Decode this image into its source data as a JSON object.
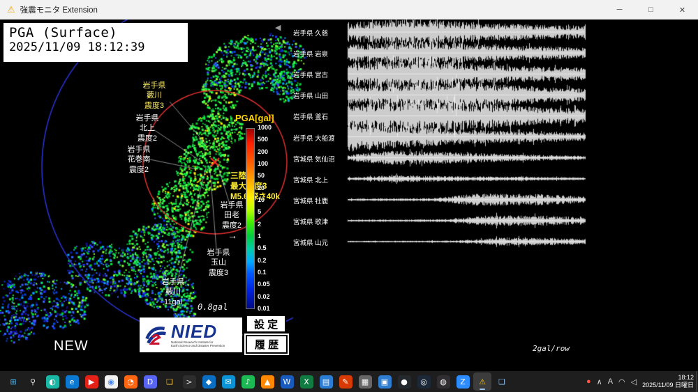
{
  "window": {
    "title": "強震モニタ Extension",
    "app_icon": "⚠",
    "controls": {
      "minimize": "─",
      "maximize": "□",
      "close": "✕"
    }
  },
  "monitor": {
    "mode": "PGA (Surface)",
    "datetime": "2025/11/09 18:12:39"
  },
  "legend": {
    "title": "PGA[gal]",
    "ticks": [
      "1000",
      "500",
      "200",
      "100",
      "50",
      "20",
      "10",
      "5",
      "2",
      "1",
      "0.5",
      "0.2",
      "0.1",
      "0.05",
      "0.02",
      "0.01"
    ],
    "current_arrow": "→"
  },
  "map_labels": {
    "yabukawa_intensity": "岩手県\n藪川\n震度3",
    "kitakami": "岩手県\n北上\n震度2",
    "hanamaki_minami": "岩手県\n花巻南\n震度2",
    "taro": "岩手県\n田老\n震度2",
    "tamayama": "岩手県\n玉山\n震度3",
    "yabukawa_gal": "岩手県\n藪川\n11gal",
    "gal_note": "0.8gal"
  },
  "epicenter": {
    "info": "三陸沖\n最大震度3\nM5.6 深さ40k"
  },
  "waveforms": {
    "marker": "◀",
    "row_scale": "2gal/row",
    "stations": [
      "岩手県 久慈",
      "岩手県 岩泉",
      "岩手県 宮古",
      "岩手県 山田",
      "岩手県 釜石",
      "岩手県 大船渡",
      "宮城県 気仙沼",
      "宮城県 北上",
      "宮城県 牡鹿",
      "宮城県 歌津",
      "宮城県 山元"
    ]
  },
  "nied": {
    "name": "NIED",
    "subtitle": "National Research Institute for\nEarth Science and Disaster Prevention"
  },
  "buttons": {
    "settings": "設 定",
    "history": "履 歴"
  },
  "new_badge": "NEW",
  "taskbar": {
    "icons": [
      {
        "name": "start-button",
        "glyph": "⊞",
        "color": "#4cc2ff",
        "bg": "none"
      },
      {
        "name": "search-button",
        "glyph": "⚲",
        "color": "#e8e8e8",
        "bg": "none"
      },
      {
        "name": "copilot-app",
        "glyph": "◐",
        "color": "#fff",
        "bg": "#19b8a6"
      },
      {
        "name": "edge-browser",
        "glyph": "e",
        "color": "#fff",
        "bg": "#0b78d1"
      },
      {
        "name": "youtube-app",
        "glyph": "▶",
        "color": "#fff",
        "bg": "#e62117"
      },
      {
        "name": "chrome-browser",
        "glyph": "◉",
        "color": "#4285f4",
        "bg": "#f1f1f1"
      },
      {
        "name": "firefox-browser",
        "glyph": "◔",
        "color": "#fff",
        "bg": "#ff6611"
      },
      {
        "name": "discord-app",
        "glyph": "D",
        "color": "#fff",
        "bg": "#5865f2"
      },
      {
        "name": "file-explorer",
        "glyph": "❏",
        "color": "#ffd04c",
        "bg": "none"
      },
      {
        "name": "terminal-app",
        "glyph": ">",
        "color": "#ddd",
        "bg": "#2d2d2d"
      },
      {
        "name": "vscode-app",
        "glyph": "◆",
        "color": "#fff",
        "bg": "#0a6fc2"
      },
      {
        "name": "mail-app",
        "glyph": "✉",
        "color": "#fff",
        "bg": "#0a93d6"
      },
      {
        "name": "spotify-app",
        "glyph": "♪",
        "color": "#fff",
        "bg": "#1db954"
      },
      {
        "name": "vlc-app",
        "glyph": "▲",
        "color": "#fff",
        "bg": "#ff8800"
      },
      {
        "name": "word-app",
        "glyph": "W",
        "color": "#fff",
        "bg": "#185abd"
      },
      {
        "name": "excel-app",
        "glyph": "X",
        "color": "#fff",
        "bg": "#107c41"
      },
      {
        "name": "notepad-app",
        "glyph": "▤",
        "color": "#fff",
        "bg": "#2b7cd3"
      },
      {
        "name": "paint-app",
        "glyph": "✎",
        "color": "#fff",
        "bg": "#d83b01"
      },
      {
        "name": "calculator-app",
        "glyph": "▦",
        "color": "#fff",
        "bg": "#666666"
      },
      {
        "name": "photos-app",
        "glyph": "▣",
        "color": "#fff",
        "bg": "#2e7dd1"
      },
      {
        "name": "github-app",
        "glyph": "●",
        "color": "#fff",
        "bg": "#24292e"
      },
      {
        "name": "steam-app",
        "glyph": "◎",
        "color": "#fff",
        "bg": "#1b2838"
      },
      {
        "name": "obs-app",
        "glyph": "◍",
        "color": "#fff",
        "bg": "#302e31"
      },
      {
        "name": "zoom-app",
        "glyph": "Z",
        "color": "#fff",
        "bg": "#2d8cff"
      },
      {
        "name": "kyoshin-monitor-app",
        "glyph": "⚠",
        "color": "#ffcc00",
        "bg": "#3c3c3c",
        "active": true
      },
      {
        "name": "folder-window",
        "glyph": "❏",
        "color": "#8ec6ff",
        "bg": "none"
      }
    ],
    "tray": {
      "icons": [
        {
          "name": "tray-app-icon",
          "glyph": "●",
          "color": "#ff5544"
        },
        {
          "name": "hidden-icons-chevron",
          "glyph": "∧",
          "color": "#ddd"
        },
        {
          "name": "ime-indicator",
          "glyph": "A",
          "color": "#ddd"
        },
        {
          "name": "network-icon",
          "glyph": "◠",
          "color": "#ddd"
        },
        {
          "name": "volume-icon",
          "glyph": "◁",
          "color": "#ddd"
        }
      ],
      "clock": {
        "time": "18:12",
        "date": "2025/11/09 日曜日"
      }
    }
  }
}
